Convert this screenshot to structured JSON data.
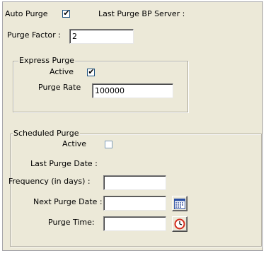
{
  "auto_purge": {
    "label": "Auto Purge",
    "checked": true
  },
  "last_purge_bp_server": {
    "label": "Last Purge BP Server :"
  },
  "purge_factor": {
    "label": "Purge Factor :",
    "value": "2"
  },
  "express_purge": {
    "title": "Express Purge",
    "active_label": "Active",
    "active_checked": true,
    "rate_label": "Purge Rate",
    "rate_value": "100000"
  },
  "scheduled_purge": {
    "title": "Scheduled Purge",
    "active_label": "Active",
    "active_checked": false,
    "last_purge_date_label": "Last Purge Date :",
    "frequency_label": "Frequency (in days) :",
    "frequency_value": "",
    "next_purge_date_label": "Next Purge Date :",
    "next_purge_date_value": "",
    "purge_time_label": "Purge Time:",
    "purge_time_value": "",
    "calendar_icon": "calendar-icon",
    "clock_icon": "clock-icon"
  },
  "colors": {
    "panel_bg": "#ece9d8",
    "clock_red": "#d42a1c",
    "calendar_blue": "#2a4fa3"
  }
}
